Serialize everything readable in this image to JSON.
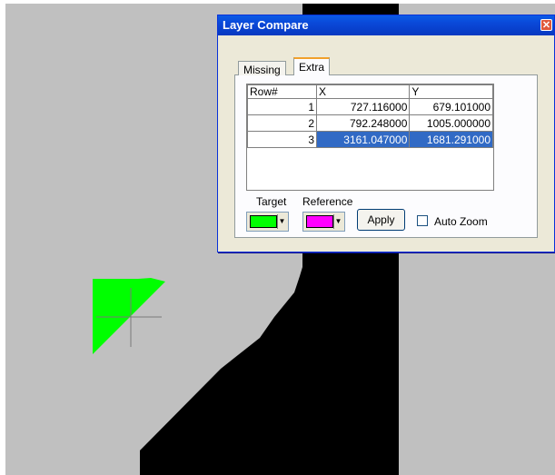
{
  "dialog": {
    "title": "Layer Compare",
    "close_glyph": "✕",
    "tabs": [
      "Missing",
      "Extra"
    ],
    "active_tab": "Extra",
    "table": {
      "headers": [
        "Row#",
        "X",
        "Y"
      ],
      "rows": [
        {
          "row": "1",
          "x": "727.116000",
          "y": "679.101000"
        },
        {
          "row": "2",
          "x": "792.248000",
          "y": "1005.000000"
        },
        {
          "row": "3",
          "x": "3161.047000",
          "y": "1681.291000"
        }
      ],
      "selected_row": "3"
    },
    "target_label": "Target",
    "reference_label": "Reference",
    "target_color": "#00ff00",
    "reference_color": "#ff00ff",
    "apply_label": "Apply",
    "auto_zoom_label": "Auto Zoom",
    "auto_zoom_checked": false
  },
  "canvas": {
    "background": "#c0c0c0",
    "shape_color": "#000000",
    "marker_color": "#00ff00"
  },
  "icons": {
    "close": "close-icon",
    "dropdown": "chevron-down-icon",
    "crosshair": "crosshair-icon"
  }
}
